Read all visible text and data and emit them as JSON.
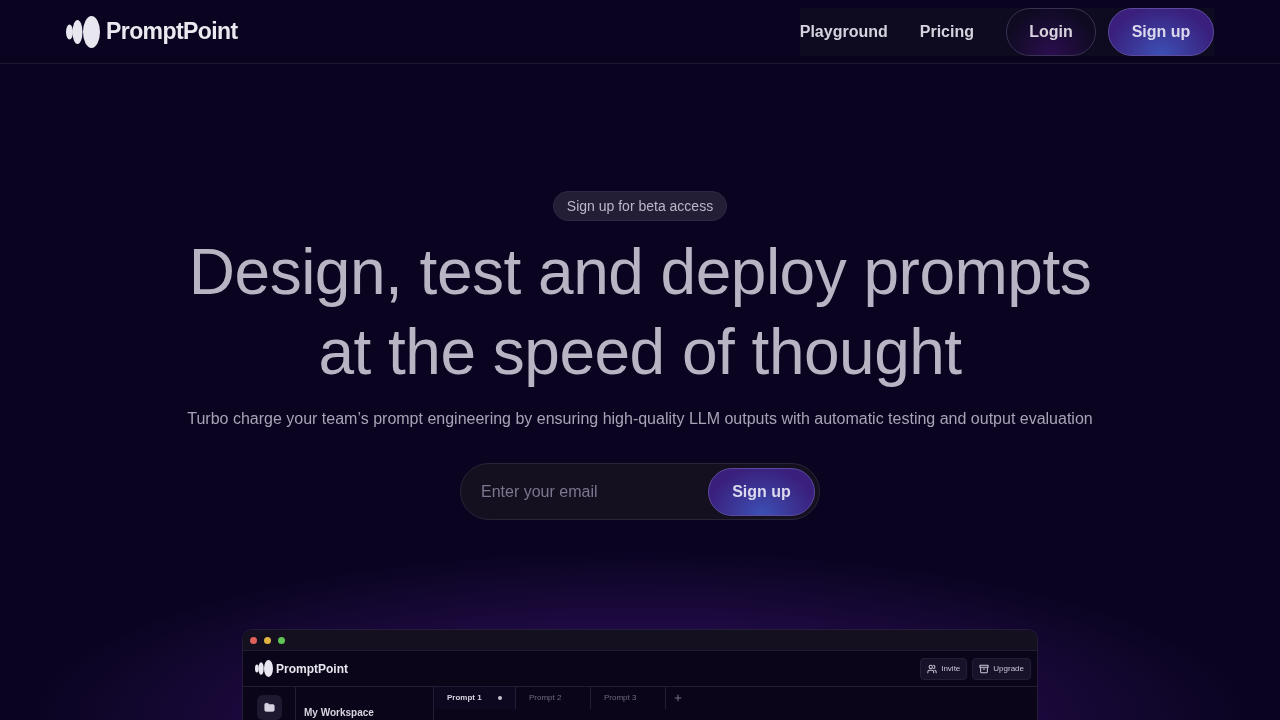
{
  "header": {
    "logo": "PromptPoint",
    "nav": [
      {
        "label": "Playground"
      },
      {
        "label": "Pricing"
      }
    ],
    "login": "Login",
    "signup": "Sign up"
  },
  "hero": {
    "badge": "Sign up for beta access",
    "headline": "Design, test and deploy prompts at the speed of thought",
    "subtitle": "Turbo charge your team’s prompt engineering by ensuring high-quality LLM outputs with automatic testing and output evaluation",
    "email": {
      "placeholder": "Enter your email"
    },
    "submit": "Sign up"
  },
  "app_preview": {
    "logo": "PromptPoint",
    "buttons": [
      {
        "label": "Invite",
        "kind": "invite"
      },
      {
        "label": "Upgrade",
        "kind": "upgrade"
      }
    ],
    "workspace": "My Workspace",
    "tabs": [
      {
        "label": "Prompt 1",
        "selected": true,
        "unsaved": true
      },
      {
        "label": "Prompt 2",
        "selected": false,
        "unsaved": false
      },
      {
        "label": "Prompt 3",
        "selected": false,
        "unsaved": false
      }
    ]
  }
}
